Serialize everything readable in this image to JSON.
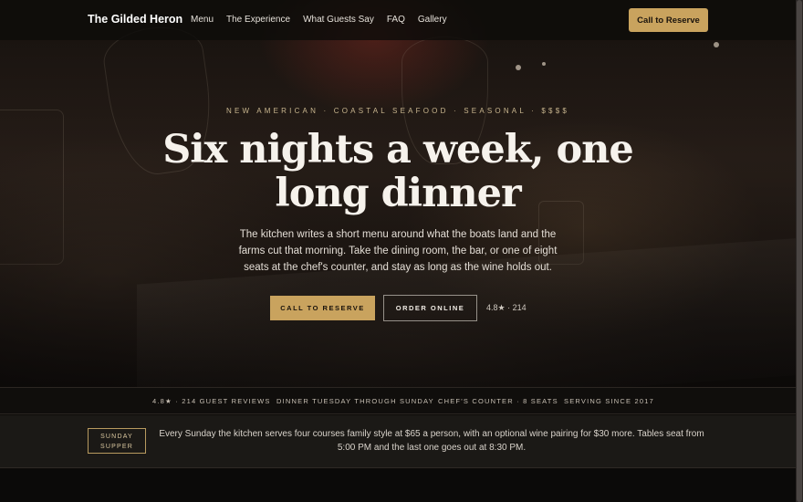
{
  "nav": {
    "brand": "The Gilded Heron",
    "links": [
      "Menu",
      "The Experience",
      "What Guests Say",
      "FAQ",
      "Gallery"
    ],
    "cta": "Call to Reserve"
  },
  "hero": {
    "eyebrow": "NEW AMERICAN · COASTAL SEAFOOD · SEASONAL · $$$$",
    "headline": "Six nights a week, one long dinner",
    "lede": "The kitchen writes a short menu around what the boats land and the farms cut that morning. Take the dining room, the bar, or one of eight seats at the chef's counter, and stay as long as the wine holds out.",
    "primary_button": "CALL TO RESERVE",
    "secondary_button": "ORDER ONLINE",
    "rating": "4.8★ · 214"
  },
  "strip": {
    "items": [
      "4.8★ · 214 GUEST REVIEWS",
      "DINNER TUESDAY THROUGH SUNDAY",
      "CHEF'S COUNTER · 8 SEATS",
      "SERVING SINCE 2017"
    ]
  },
  "announcement": {
    "badge_line1": "SUNDAY",
    "badge_line2": "SUPPER",
    "text": "Every Sunday the kitchen serves four courses family style at $65 a person, with an optional wine pairing for $30 more. Tables seat from 5:00 PM and the last one goes out at 8:30 PM."
  },
  "colors": {
    "accent": "#c9a35e",
    "background": "#0d0b09"
  }
}
